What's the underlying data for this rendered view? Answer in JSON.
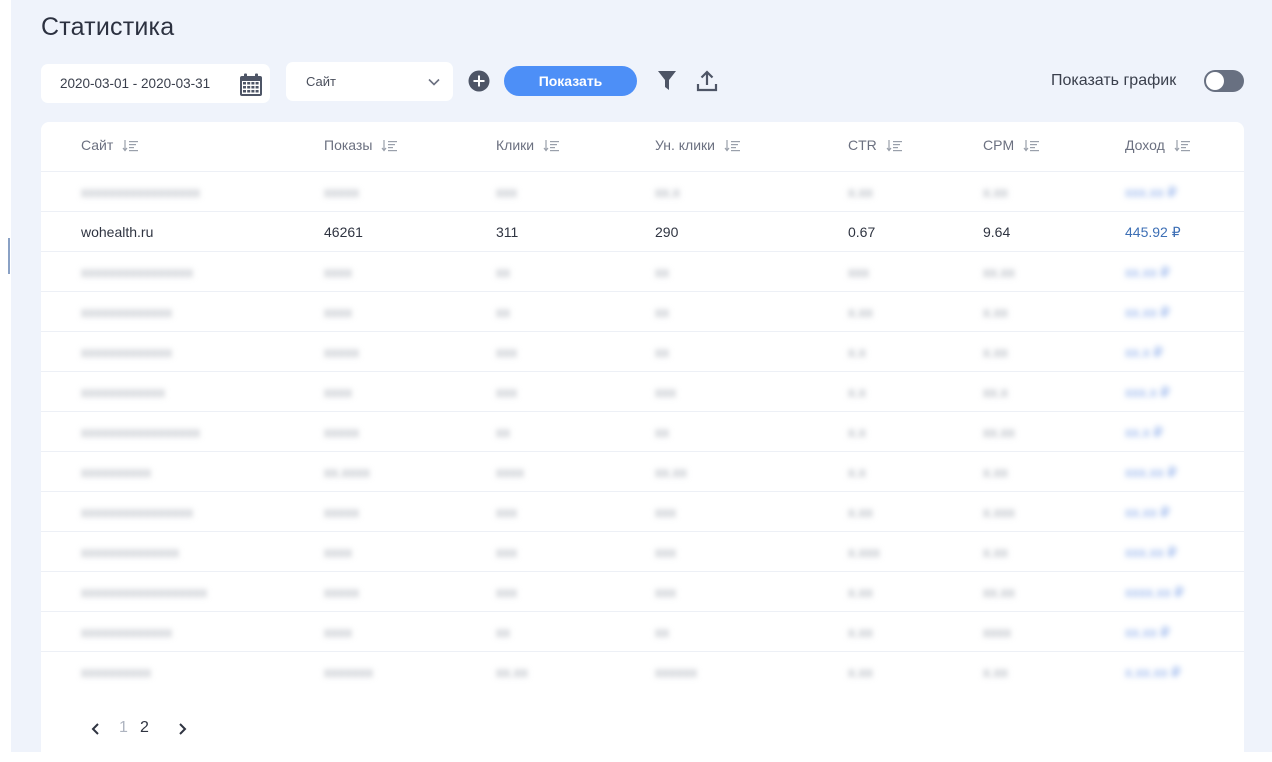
{
  "page": {
    "title": "Статистика"
  },
  "filters": {
    "date_range": "2020-03-01 - 2020-03-31",
    "site_select": "Сайт",
    "show_button": "Показать",
    "show_chart_label": "Показать график",
    "show_chart_on": false
  },
  "table": {
    "headers": [
      "Сайт",
      "Показы",
      "Клики",
      "Ун. клики",
      "CTR",
      "CPM",
      "Доход"
    ],
    "rows": [
      [
        "xxxxxxxxxxxxxxxxx",
        "xxxxx",
        "xxx",
        "xx.x",
        "x.xx",
        "x.xx",
        "xxx.xx ₽"
      ],
      [
        "wohealth.ru",
        "46261",
        "311",
        "290",
        "0.67",
        "9.64",
        "445.92  ₽"
      ],
      [
        "xxxxxxxxxxxxxxxx",
        "xxxx",
        "xx",
        "xx",
        "xxx",
        "xx.xx",
        "xx.xx ₽"
      ],
      [
        "xxxxxxxxxxxxx",
        "xxxx",
        "xx",
        "xx",
        "x.xx",
        "x.xx",
        "xx.xx ₽"
      ],
      [
        "xxxxxxxxxxxxx",
        "xxxxx",
        "xxx",
        "xx",
        "x.x",
        "x.xx",
        "xx.x ₽"
      ],
      [
        "xxxxxxxxxxxx",
        "xxxx",
        "xxx",
        "xxx",
        "x.x",
        "xx.x",
        "xxx.x ₽"
      ],
      [
        "xxxxxxxxxxxxxxxxx",
        "xxxxx",
        "xx",
        "xx",
        "x.x",
        "xx.xx",
        "xx.x ₽"
      ],
      [
        "xxxxxxxxxx",
        "xx.xxxx",
        "xxxx",
        "xx.xx",
        "x.x",
        "x.xx",
        "xxx.xx ₽"
      ],
      [
        "xxxxxxxxxxxxxxxx",
        "xxxxx",
        "xxx",
        "xxx",
        "x.xx",
        "x.xxx",
        "xx.xx ₽"
      ],
      [
        "xxxxxxxxxxxxxx",
        "xxxx",
        "xxx",
        "xxx",
        "x.xxx",
        "x.xx",
        "xxx.xx ₽"
      ],
      [
        "xxxxxxxxxxxxxxxxxx",
        "xxxxx",
        "xxx",
        "xxx",
        "x.xx",
        "xx.xx",
        "xxxx.xx ₽"
      ],
      [
        "xxxxxxxxxxxxx",
        "xxxx",
        "xx",
        "xx",
        "x.xx",
        "xxxx",
        "xx.xx ₽"
      ],
      [
        "xxxxxxxxxx",
        "xxxxxxx",
        "xx.xx",
        "xxxxxx",
        "x.xx",
        "x.xx",
        "x.xx.xx ₽"
      ]
    ],
    "blurred": [
      true,
      false,
      true,
      true,
      true,
      true,
      true,
      true,
      true,
      true,
      true,
      true,
      true
    ]
  },
  "pagination": {
    "pages": [
      "1",
      "2"
    ],
    "current": "1"
  },
  "colors": {
    "accent": "#4d8ff7",
    "background": "#eff3fb",
    "income_link": "#3d6fb5",
    "toggle_off": "#687081"
  },
  "icons": {
    "calendar": "calendar-icon",
    "chevron": "chevron-down-icon",
    "add": "plus-circle-icon",
    "filter": "filter-icon",
    "export": "upload-icon",
    "sort": "sort-icon",
    "prev": "chevron-left-icon",
    "next": "chevron-right-icon"
  }
}
